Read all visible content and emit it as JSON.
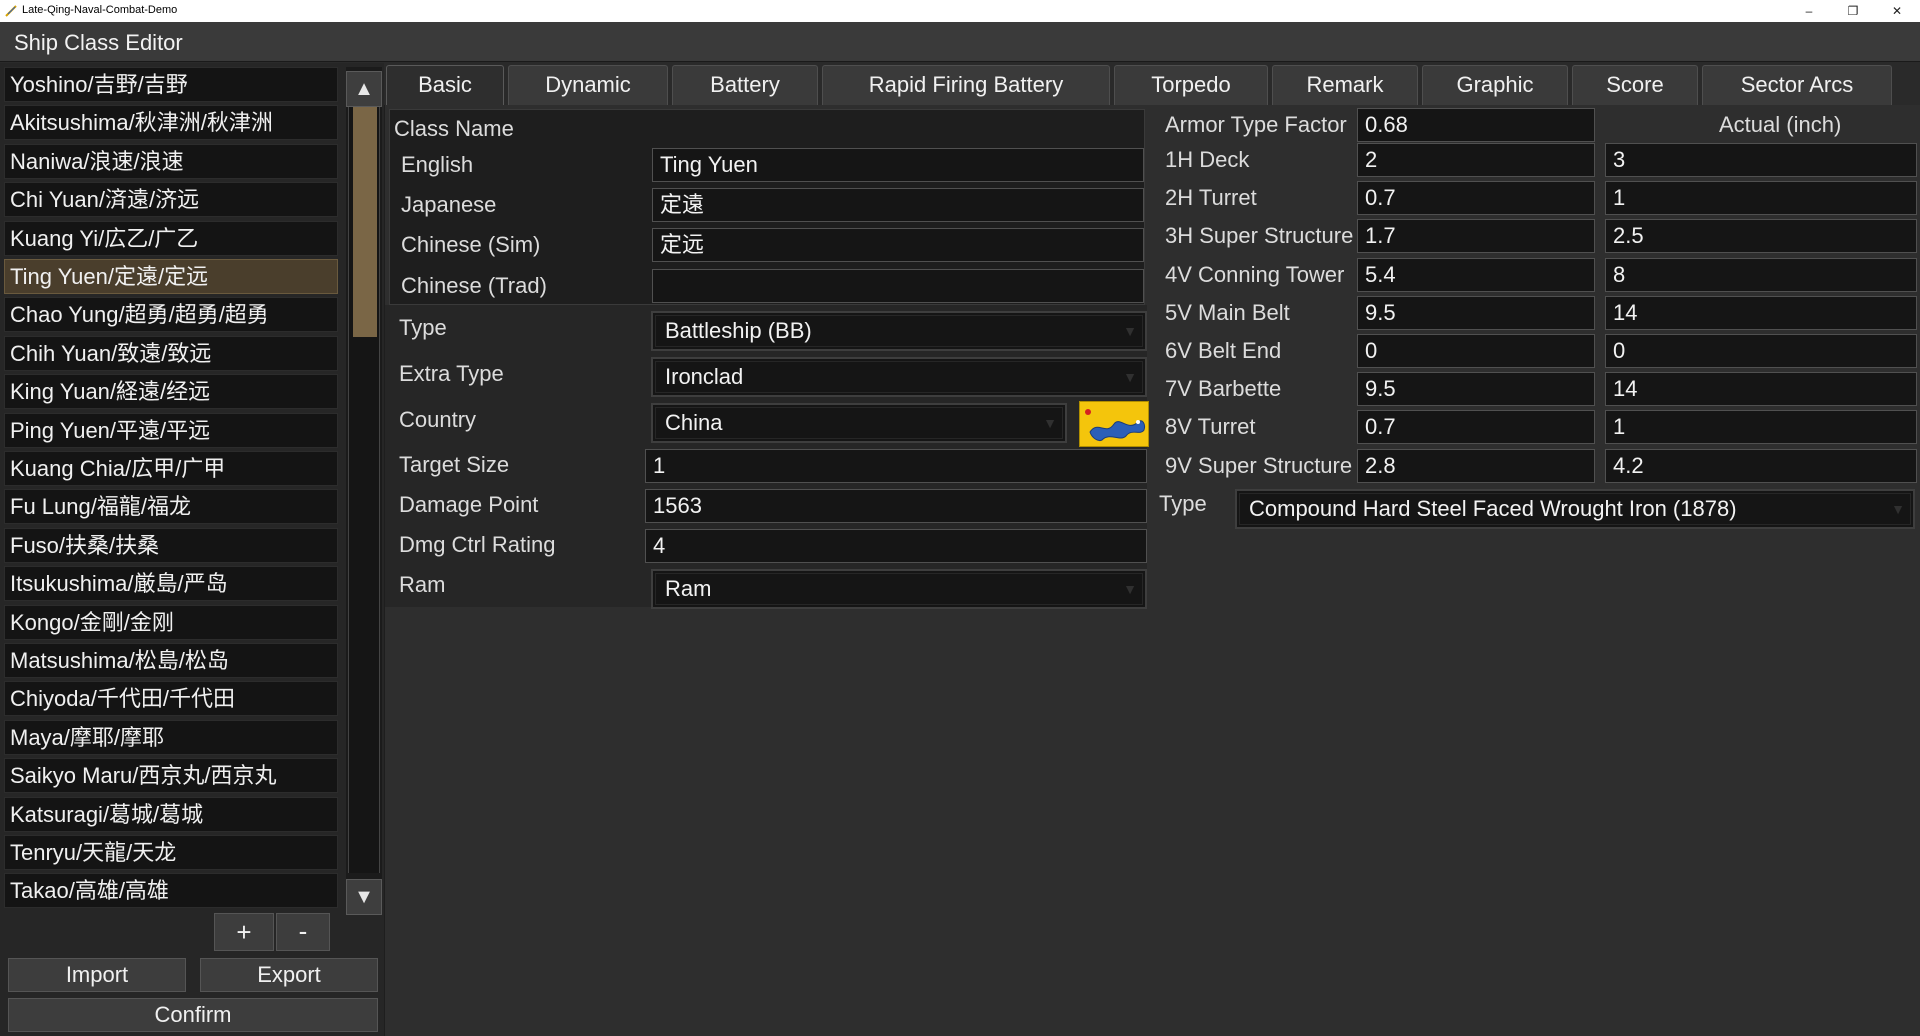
{
  "window": {
    "title": "Late-Qing-Naval-Combat-Demo",
    "minimize": "–",
    "restore": "❐",
    "close": "✕",
    "icon": "app-feather-icon"
  },
  "header": {
    "title": "Ship Class Editor"
  },
  "ship_list": {
    "selected_index": 5,
    "items": [
      "Yoshino/吉野/吉野",
      "Akitsushima/秋津洲/秋津洲",
      "Naniwa/浪速/浪速",
      "Chi Yuan/済遠/济远",
      "Kuang Yi/広乙/广乙",
      "Ting Yuen/定遠/定远",
      "Chao Yung/超勇/超勇/超勇",
      "Chih Yuan/致遠/致远",
      "King Yuan/経遠/经远",
      "Ping Yuen/平遠/平远",
      "Kuang Chia/広甲/广甲",
      "Fu Lung/福龍/福龙",
      "Fuso/扶桑/扶桑",
      "Itsukushima/厳島/严岛",
      "Kongo/金剛/金刚",
      "Matsushima/松島/松岛",
      "Chiyoda/千代田/千代田",
      "Maya/摩耶/摩耶",
      "Saikyo Maru/西京丸/西京丸",
      "Katsuragi/葛城/葛城",
      "Tenryu/天龍/天龙",
      "Takao/高雄/高雄"
    ],
    "scroll_up": "▲",
    "scroll_down": "▼",
    "scroll_position": 0.0
  },
  "list_controls": {
    "add": "+",
    "remove": "-",
    "import": "Import",
    "export": "Export",
    "confirm": "Confirm"
  },
  "tabs": {
    "active": "Basic",
    "items": [
      "Basic",
      "Dynamic",
      "Battery",
      "Rapid Firing Battery",
      "Torpedo",
      "Remark",
      "Graphic",
      "Score",
      "Sector Arcs"
    ]
  },
  "basic": {
    "class_name_label": "Class Name",
    "english_label": "English",
    "english_value": "Ting Yuen",
    "japanese_label": "Japanese",
    "japanese_value": "定遠",
    "chinese_sim_label": "Chinese (Sim)",
    "chinese_sim_value": "定远",
    "chinese_trad_label": "Chinese (Trad)",
    "chinese_trad_value": "",
    "type_label": "Type",
    "type_value": "Battleship (BB)",
    "extra_type_label": "Extra Type",
    "extra_type_value": "Ironclad",
    "country_label": "Country",
    "country_value": "China",
    "country_flag": "qing-dragon-flag-icon",
    "target_size_label": "Target Size",
    "target_size_value": "1",
    "damage_point_label": "Damage Point",
    "damage_point_value": "1563",
    "dmg_ctrl_label": "Dmg Ctrl Rating",
    "dmg_ctrl_value": "4",
    "ram_label": "Ram",
    "ram_value": "Ram"
  },
  "armor": {
    "factor_label": "Armor Type Factor",
    "factor_value": "0.68",
    "actual_header": "Actual (inch)",
    "rows": [
      {
        "label": "1H Deck",
        "factor": "2",
        "actual": "3"
      },
      {
        "label": "2H Turret",
        "factor": "0.7",
        "actual": "1"
      },
      {
        "label": "3H Super Structure",
        "factor": "1.7",
        "actual": "2.5"
      },
      {
        "label": "4V Conning Tower",
        "factor": "5.4",
        "actual": "8"
      },
      {
        "label": "5V Main Belt",
        "factor": "9.5",
        "actual": "14"
      },
      {
        "label": "6V Belt End",
        "factor": "0",
        "actual": "0"
      },
      {
        "label": "7V Barbette",
        "factor": "9.5",
        "actual": "14"
      },
      {
        "label": "8V Turret",
        "factor": "0.7",
        "actual": "1"
      },
      {
        "label": "9V Super Structure",
        "factor": "2.8",
        "actual": "4.2"
      }
    ],
    "type_label": "Type",
    "type_value": "Compound Hard Steel Faced Wrought Iron (1878)"
  },
  "colors": {
    "selected_row": "#4a3e2c",
    "scroll_thumb": "#7a6646",
    "flag_yellow": "#f4c50c"
  }
}
